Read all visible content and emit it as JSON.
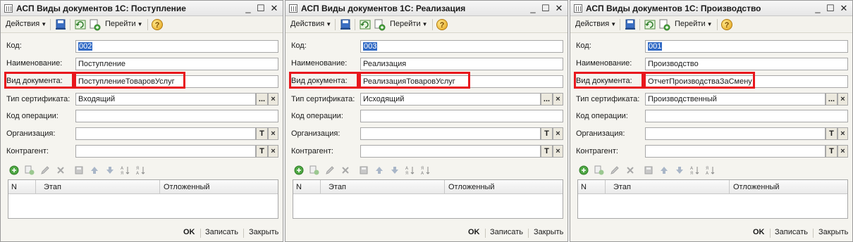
{
  "labels": {
    "actions": "Действия",
    "goto": "Перейти",
    "code": "Код:",
    "name": "Наименование:",
    "doc_type": "Вид документа:",
    "cert_type": "Тип сертификата:",
    "op_code": "Код операции:",
    "organization": "Организация:",
    "counterparty": "Контрагент:",
    "col_n": "N",
    "col_stage": "Этап",
    "col_deferred": "Отложенный",
    "ok": "OK",
    "save": "Записать",
    "close": "Закрыть",
    "ellipsis": "...",
    "t_btn": "T",
    "x_btn": "×",
    "help": "?"
  },
  "windows": [
    {
      "title": "АСП Виды документов 1С: Поступление",
      "code": "002",
      "name": "Поступление",
      "doc_type": "ПоступлениеТоваровУслуг",
      "cert_type": "Входящий",
      "op_code": "",
      "organization": "",
      "counterparty": ""
    },
    {
      "title": "АСП Виды документов 1С: Реализация",
      "code": "003",
      "name": "Реализация",
      "doc_type": "РеализацияТоваровУслуг",
      "cert_type": "Исходящий",
      "op_code": "",
      "organization": "",
      "counterparty": ""
    },
    {
      "title": "АСП Виды документов 1С: Производство",
      "code": "001",
      "name": "Производство",
      "doc_type": "ОтчетПроизводстваЗаСмену",
      "cert_type": "Производственный",
      "op_code": "",
      "organization": "",
      "counterparty": ""
    }
  ],
  "colors": {
    "highlight": "#e8171d",
    "selection": "#316ac5"
  }
}
